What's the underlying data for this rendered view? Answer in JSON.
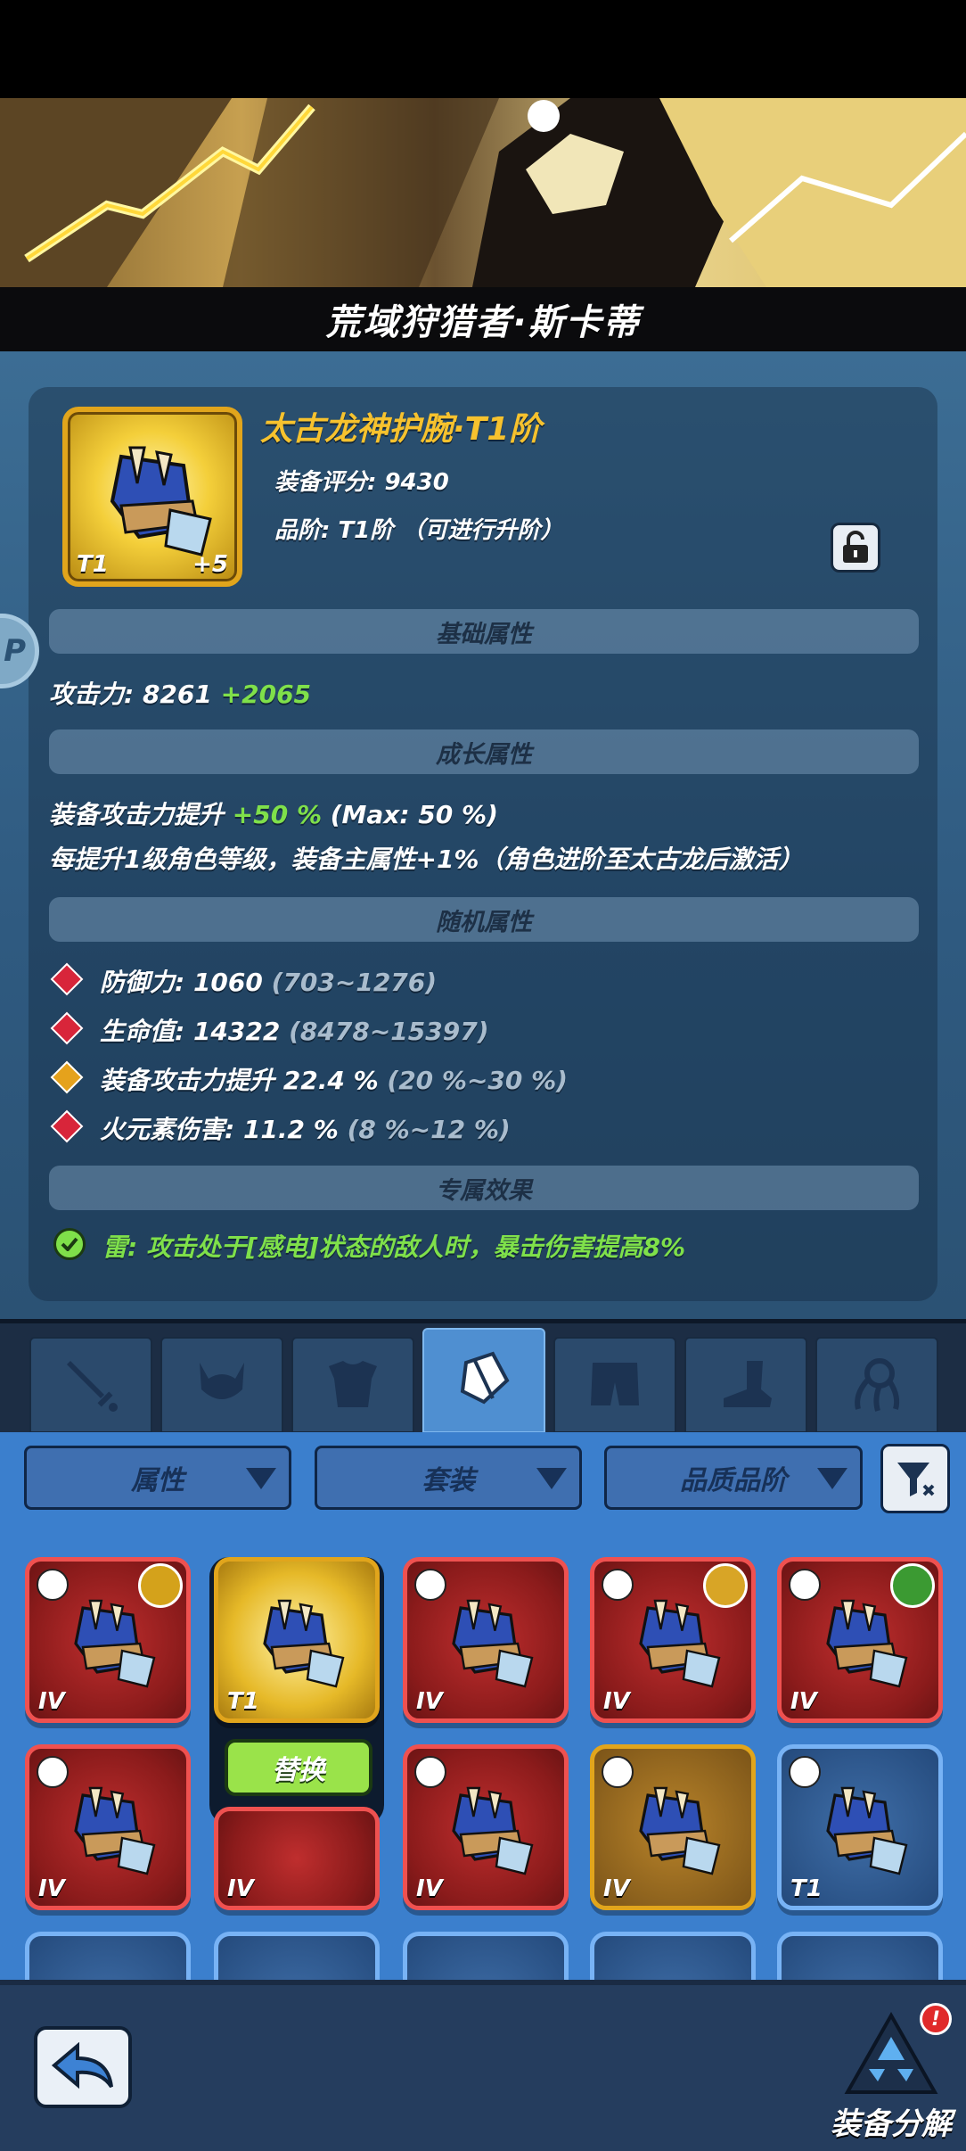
{
  "title": "荒域狩猎者·斯卡蒂",
  "item": {
    "name": "太古龙神护腕·T1阶",
    "score_line": "装备评分: 9430",
    "grade_line": "品阶: T1阶 （可进行升阶）",
    "tier": "T1",
    "plus": "+5"
  },
  "sections": {
    "base": "基础属性",
    "growth": "成长属性",
    "random": "随机属性",
    "exclusive": "专属效果"
  },
  "base_attr": {
    "label": "攻击力: 8261",
    "bonus": "+2065"
  },
  "growth_attr": {
    "line1_a": "装备攻击力提升",
    "line1_b": "+50 %",
    "line1_c": "(Max: 50 %)",
    "line2": "每提升1级角色等级，装备主属性+1%（角色进阶至太古龙后激活）"
  },
  "random_attrs": [
    {
      "text": "防御力: 1060",
      "range": "(703~1276)",
      "gem": "red"
    },
    {
      "text": "生命值: 14322",
      "range": "(8478~15397)",
      "gem": "red"
    },
    {
      "text": "装备攻击力提升 22.4 %",
      "range": "(20 %~30 %)",
      "gem": "gold"
    },
    {
      "text": "火元素伤害: 11.2 %",
      "range": "(8 %~12 %)",
      "gem": "red"
    }
  ],
  "exclusive_effect": "雷: 攻击处于[感电]状态的敌人时，暴击伤害提高8%",
  "tabs": [
    {
      "icon": "sword-icon"
    },
    {
      "icon": "helmet-icon"
    },
    {
      "icon": "armor-icon"
    },
    {
      "icon": "bracer-icon",
      "active": true
    },
    {
      "icon": "pants-icon"
    },
    {
      "icon": "boots-icon"
    },
    {
      "icon": "accessory-icon"
    }
  ],
  "filters": {
    "attr": "属性",
    "set": "套装",
    "quality": "品质品阶"
  },
  "slots": [
    {
      "tier": "IV",
      "style": "red",
      "elem": "#d4a21b"
    },
    {
      "tier": "T1",
      "style": "yellow",
      "selected": true
    },
    {
      "tier": "IV",
      "style": "red"
    },
    {
      "tier": "IV",
      "style": "red",
      "elem": "#d8a526"
    },
    {
      "tier": "IV",
      "style": "red",
      "elem": "#3b9a32"
    },
    {
      "tier": "IV",
      "style": "red"
    },
    {
      "tier": "IV",
      "style": "red"
    },
    {
      "tier": "IV",
      "style": "red"
    },
    {
      "tier": "IV",
      "style": "gold"
    },
    {
      "tier": "T1",
      "style": "blue"
    }
  ],
  "replace_label": "替换",
  "dismantle_label": "装备分解",
  "dismantle_alert": "!",
  "side_tab_letter": "P"
}
